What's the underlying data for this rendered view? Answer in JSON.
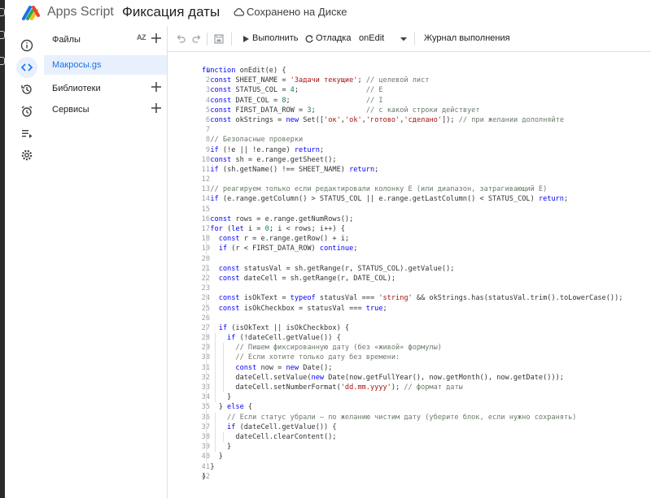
{
  "header": {
    "app_name": "Apps Script",
    "project_name": "Фиксация даты",
    "save_status": "Сохранено на Диске"
  },
  "sidebar": {
    "files_label": "Файлы",
    "sort_icon_text": "AZ",
    "active_file": "Макросы.gs",
    "libraries_label": "Библиотеки",
    "services_label": "Сервисы"
  },
  "toolbar": {
    "run_label": "Выполнить",
    "debug_label": "Отладка",
    "function_name": "onEdit",
    "log_label": "Журнал выполнения"
  },
  "code_lines": [
    "function onEdit(e) {",
    "  const SHEET_NAME = 'Задачи текущие'; // целевой лист",
    "  const STATUS_COL = 4;                // E",
    "  const DATE_COL = 8;                  // I",
    "  const FIRST_DATA_ROW = 3;            // с какой строки действует",
    "  const okStrings = new Set(['ок','ok','готово','сделано']); // при желании дополняйте",
    "",
    "  // Безопасные проверки",
    "  if (!e || !e.range) return;",
    "  const sh = e.range.getSheet();",
    "  if (sh.getName() !== SHEET_NAME) return;",
    "",
    "  // реагируем только если редактировали колонку E (или диапазон, затрагивающий E)",
    "  if (e.range.getColumn() > STATUS_COL || e.range.getLastColumn() < STATUS_COL) return;",
    "",
    "  const rows = e.range.getNumRows();",
    "  for (let i = 0; i < rows; i++) {",
    "    const r = e.range.getRow() + i;",
    "    if (r < FIRST_DATA_ROW) continue;",
    "",
    "    const statusVal = sh.getRange(r, STATUS_COL).getValue();",
    "    const dateCell = sh.getRange(r, DATE_COL);",
    "",
    "    const isOkText = typeof statusVal === 'string' && okStrings.has(statusVal.trim().toLowerCase());",
    "    const isOkCheckbox = statusVal === true;",
    "",
    "    if (isOkText || isOkCheckbox) {",
    "      if (!dateCell.getValue()) {",
    "        // Пишем фиксированную дату (без «живой» формулы)",
    "        // Если хотите только дату без времени:",
    "        const now = new Date();",
    "        dateCell.setValue(new Date(now.getFullYear(), now.getMonth(), now.getDate()));",
    "        dateCell.setNumberFormat('dd.mm.yyyy'); // формат даты",
    "      }",
    "    } else {",
    "      // Если статус убрали — по желанию чистим дату (уберите блок, если нужно сохранять)",
    "      if (dateCell.getValue()) {",
    "        dateCell.clearContent();",
    "      }",
    "    }",
    "  }",
    "}"
  ],
  "colors": {
    "accent": "#1a73e8",
    "active_bg": "#e8f0fe",
    "keyword": "#0000ff",
    "string": "#a31515",
    "comment": "#6a7a6a"
  }
}
